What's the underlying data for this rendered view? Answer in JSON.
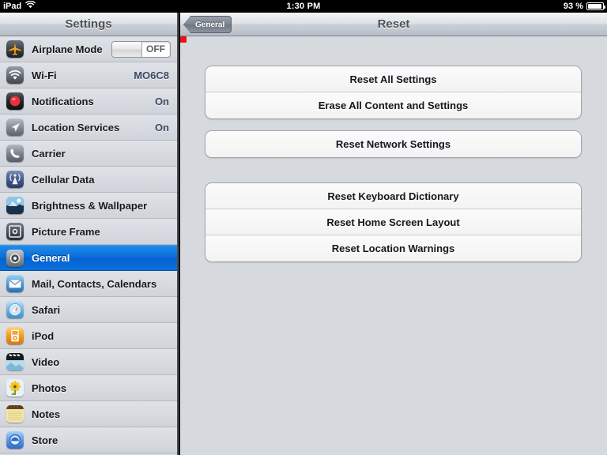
{
  "status_bar": {
    "device_label": "iPad",
    "wifi_icon": "wifi-icon",
    "time": "1:30 PM",
    "battery_percent": "93 %",
    "battery_icon": "battery-icon"
  },
  "sidebar": {
    "title": "Settings",
    "items": [
      {
        "label": "Airplane Mode",
        "icon": "airplane-icon",
        "control": "toggle",
        "toggle_state": "OFF",
        "selected": false
      },
      {
        "label": "Wi-Fi",
        "icon": "wifi-settings-icon",
        "value": "MO6C8",
        "selected": false
      },
      {
        "label": "Notifications",
        "icon": "notifications-icon",
        "value": "On",
        "selected": false
      },
      {
        "label": "Location Services",
        "icon": "location-services-icon",
        "value": "On",
        "selected": false
      },
      {
        "label": "Carrier",
        "icon": "carrier-icon",
        "value": "",
        "selected": false
      },
      {
        "label": "Cellular Data",
        "icon": "cellular-data-icon",
        "value": "",
        "selected": false
      },
      {
        "label": "Brightness & Wallpaper",
        "icon": "brightness-wallpaper-icon",
        "value": "",
        "selected": false
      },
      {
        "label": "Picture Frame",
        "icon": "picture-frame-icon",
        "value": "",
        "selected": false
      },
      {
        "label": "General",
        "icon": "general-gear-icon",
        "value": "",
        "selected": true
      },
      {
        "label": "Mail, Contacts, Calendars",
        "icon": "mail-icon",
        "value": "",
        "selected": false
      },
      {
        "label": "Safari",
        "icon": "safari-icon",
        "value": "",
        "selected": false
      },
      {
        "label": "iPod",
        "icon": "ipod-icon",
        "value": "",
        "selected": false
      },
      {
        "label": "Video",
        "icon": "video-icon",
        "value": "",
        "selected": false
      },
      {
        "label": "Photos",
        "icon": "photos-icon",
        "value": "",
        "selected": false
      },
      {
        "label": "Notes",
        "icon": "notes-icon",
        "value": "",
        "selected": false
      },
      {
        "label": "Store",
        "icon": "store-icon",
        "value": "",
        "selected": false
      }
    ]
  },
  "detail": {
    "title": "Reset",
    "back_button_label": "General",
    "groups": [
      {
        "cells": [
          "Reset All Settings",
          "Erase All Content and Settings"
        ]
      },
      {
        "cells": [
          "Reset Network Settings"
        ]
      },
      {
        "cells": [
          "Reset Keyboard Dictionary",
          "Reset Home Screen Layout",
          "Reset Location Warnings"
        ]
      }
    ]
  },
  "annotation": {
    "color": "#ee1111",
    "target_label": "Erase All Content and Settings"
  }
}
